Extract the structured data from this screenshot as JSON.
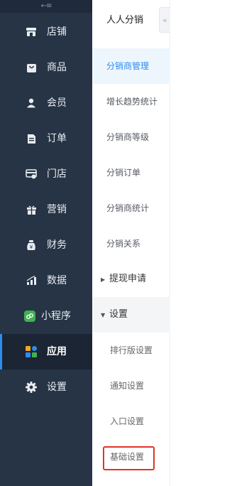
{
  "sidebar": {
    "collapse_glyph": "←≡",
    "items": [
      {
        "label": "店铺",
        "icon": "store-icon"
      },
      {
        "label": "商品",
        "icon": "bag-icon"
      },
      {
        "label": "会员",
        "icon": "user-icon"
      },
      {
        "label": "订单",
        "icon": "document-icon"
      },
      {
        "label": "门店",
        "icon": "shop-card-icon"
      },
      {
        "label": "营销",
        "icon": "gift-icon"
      },
      {
        "label": "财务",
        "icon": "money-bag-icon"
      },
      {
        "label": "数据",
        "icon": "bar-chart-icon"
      },
      {
        "label": "小程序",
        "icon": "mini-program-icon"
      },
      {
        "label": "应用",
        "icon": "apps-grid-icon",
        "active": true
      },
      {
        "label": "设置",
        "icon": "gear-icon"
      }
    ]
  },
  "subpanel": {
    "title": "人人分销",
    "collapse_tab_glyph": "«",
    "items": [
      {
        "label": "分销商管理",
        "active": true
      },
      {
        "label": "增长趋势统计"
      },
      {
        "label": "分销商等级"
      },
      {
        "label": "分销订单"
      },
      {
        "label": "分销商统计"
      },
      {
        "label": "分销关系"
      }
    ],
    "withdraw_group": {
      "label": "提现申请",
      "caret": "▶"
    },
    "settings_group": {
      "label": "设置",
      "caret": "▼",
      "children": [
        "排行版设置",
        "通知设置",
        "入口设置",
        "基础设置"
      ]
    }
  },
  "colors": {
    "sidebar_bg": "#263445",
    "active_bg": "#1b2533",
    "accent": "#2d8cf0",
    "highlight_border": "#e0332b"
  }
}
